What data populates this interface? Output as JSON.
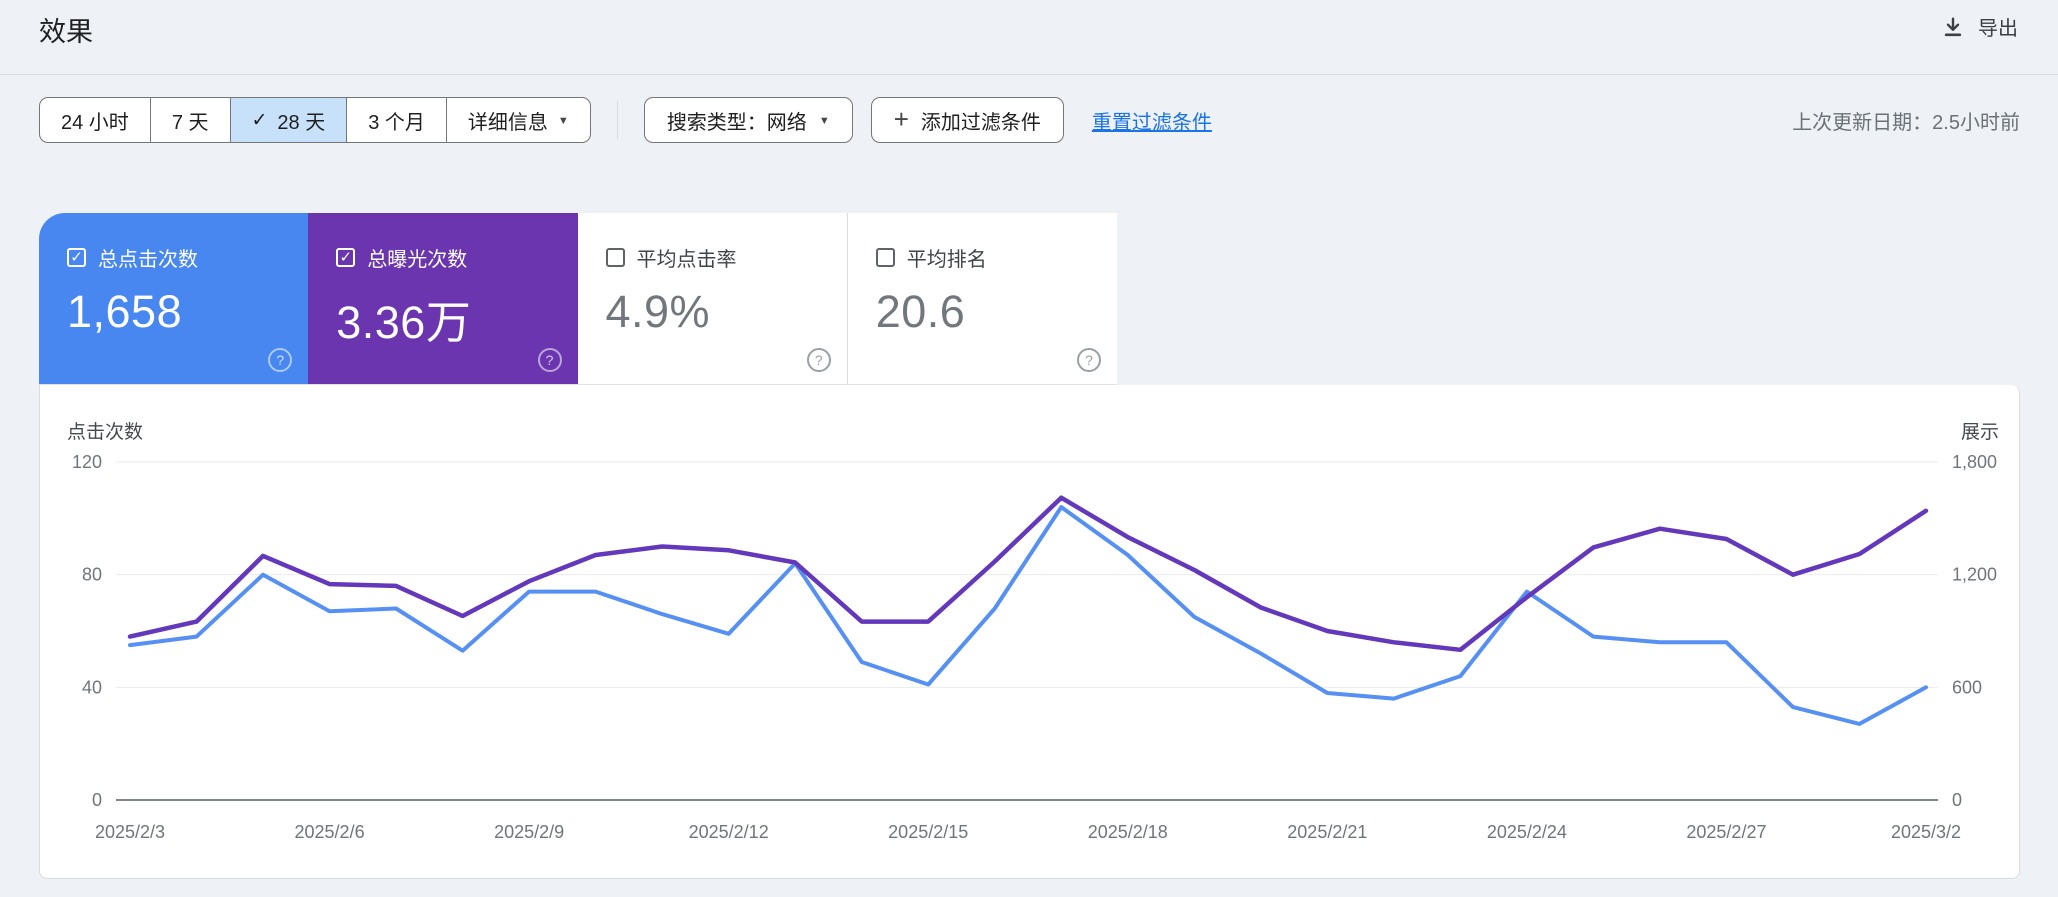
{
  "header": {
    "title": "效果",
    "export_label": "导出"
  },
  "filters": {
    "date_ranges": [
      {
        "label": "24 小时",
        "selected": false
      },
      {
        "label": "7 天",
        "selected": false
      },
      {
        "label": "28 天",
        "selected": true
      },
      {
        "label": "3 个月",
        "selected": false
      }
    ],
    "detail_label": "详细信息",
    "search_type_label": "搜索类型：网络",
    "add_filter_label": "添加过滤条件",
    "reset_filters_label": "重置过滤条件",
    "last_updated": "上次更新日期：2.5小时前"
  },
  "icons": {
    "check": "✓",
    "arrow_down": "▼",
    "plus": "+",
    "help": "?"
  },
  "metrics": [
    {
      "label": "总点击次数",
      "value": "1,658",
      "checked": true,
      "color": "#4787ef"
    },
    {
      "label": "总曝光次数",
      "value": "3.36万",
      "checked": true,
      "color": "#6a35af"
    },
    {
      "label": "平均点击率",
      "value": "4.9%",
      "checked": false,
      "color": "#ffffff"
    },
    {
      "label": "平均排名",
      "value": "20.6",
      "checked": false,
      "color": "#ffffff"
    }
  ],
  "chart_data": {
    "type": "line",
    "title": "",
    "x": [
      "2025/2/3",
      "2025/2/4",
      "2025/2/5",
      "2025/2/6",
      "2025/2/7",
      "2025/2/8",
      "2025/2/9",
      "2025/2/10",
      "2025/2/11",
      "2025/2/12",
      "2025/2/13",
      "2025/2/14",
      "2025/2/15",
      "2025/2/16",
      "2025/2/17",
      "2025/2/18",
      "2025/2/19",
      "2025/2/20",
      "2025/2/21",
      "2025/2/22",
      "2025/2/23",
      "2025/2/24",
      "2025/2/25",
      "2025/2/26",
      "2025/2/27",
      "2025/2/28",
      "2025/3/1",
      "2025/3/2"
    ],
    "x_tick_labels": [
      "2025/2/3",
      "2025/2/6",
      "2025/2/9",
      "2025/2/12",
      "2025/2/15",
      "2025/2/18",
      "2025/2/21",
      "2025/2/24",
      "2025/2/27",
      "2025/3/2"
    ],
    "series": [
      {
        "name": "点击次数",
        "axis": "left",
        "color": "#5590f2",
        "values": [
          55,
          58,
          80,
          67,
          68,
          53,
          74,
          74,
          66,
          59,
          84,
          49,
          41,
          68,
          104,
          87,
          65,
          52,
          38,
          36,
          44,
          74,
          58,
          56,
          56,
          33,
          27,
          40
        ]
      },
      {
        "name": "展示",
        "axis": "right",
        "color": "#6438bb",
        "values": [
          870,
          950,
          1300,
          1150,
          1140,
          980,
          1165,
          1305,
          1350,
          1330,
          1265,
          950,
          950,
          1270,
          1610,
          1400,
          1225,
          1025,
          900,
          840,
          800,
          1080,
          1345,
          1445,
          1390,
          1200,
          1310,
          1540
        ]
      }
    ],
    "left_axis": {
      "label": "点击次数",
      "max": 120,
      "ticks": [
        0,
        40,
        80,
        120
      ],
      "tick_labels": [
        "0",
        "40",
        "80",
        "120"
      ]
    },
    "right_axis": {
      "label": "展示",
      "max": 1800,
      "ticks": [
        0,
        600,
        1200,
        1800
      ],
      "tick_labels": [
        "0",
        "600",
        "1,200",
        "1,800"
      ]
    },
    "grid": true,
    "legend_position": "none"
  }
}
